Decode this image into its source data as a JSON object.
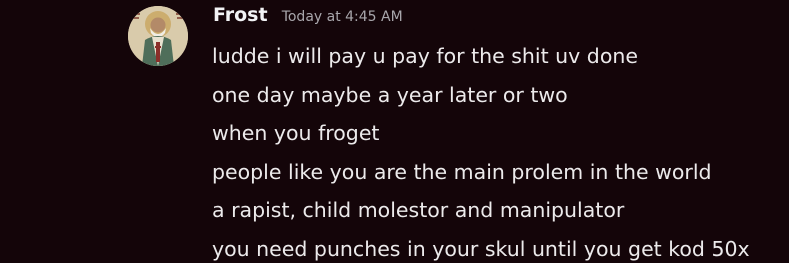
{
  "message": {
    "avatar_icon": "saint-icon-avatar",
    "author": "Frost",
    "timestamp": "Today at 4:45 AM",
    "lines": [
      "ludde i will pay u pay for the shit uv done",
      "one day maybe a year later or two",
      "when you froget",
      "people like you are the main prolem in the world",
      "a rapist, child molestor and manipulator",
      "you need punches in your skul until you get kod 50x"
    ]
  },
  "colors": {
    "background": "#140509",
    "username": "#f2f3f5",
    "timestamp": "#a8a6ab",
    "text": "#eceaeb"
  }
}
